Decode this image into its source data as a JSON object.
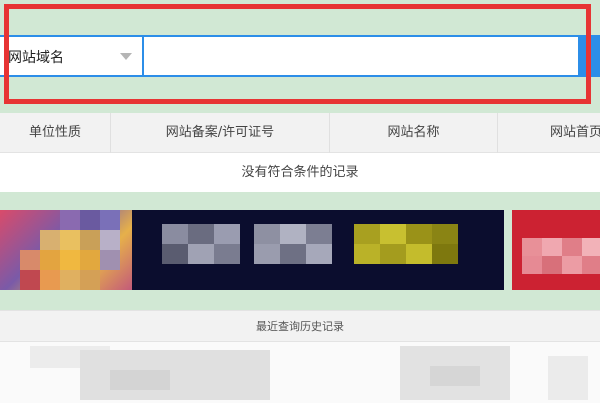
{
  "search": {
    "type_selected": "网站域名",
    "query_value": "",
    "query_placeholder": ""
  },
  "table": {
    "columns": [
      "单位性质",
      "网站备案/许可证号",
      "网站名称",
      "网站首页"
    ],
    "empty_message": "没有符合条件的记录"
  },
  "history": {
    "title": "最近查询历史记录"
  },
  "colors": {
    "accent": "#2c8ee8",
    "band_green": "#d1e8d4",
    "highlight_red": "#e73434"
  }
}
